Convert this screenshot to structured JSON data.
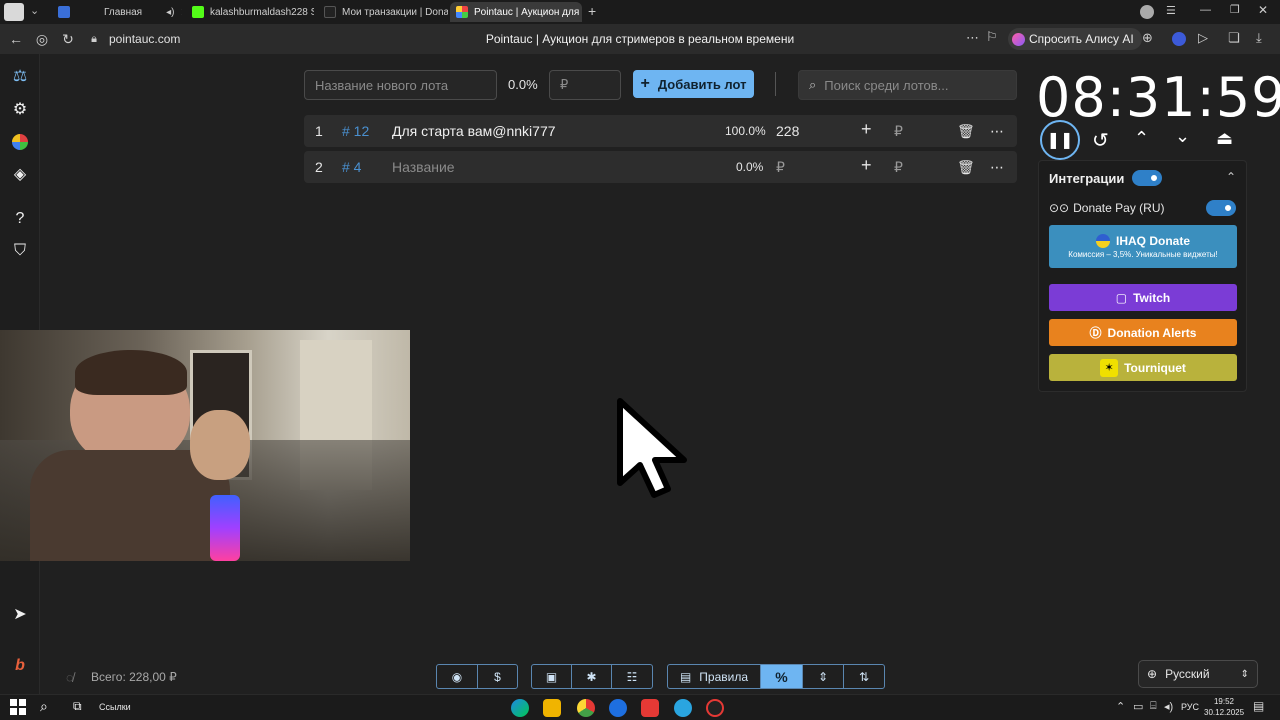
{
  "browser": {
    "tabs": [
      {
        "label": "Главная"
      },
      {
        "label": "kalashburmaldash228 Stre"
      },
      {
        "label": "Мои транзакции | Donate"
      },
      {
        "label": "Pointauc | Аукцион для ст"
      }
    ],
    "url": "pointauc.com",
    "page_title": "Pointauc | Аукцион для стримеров в реальном времени",
    "alice_label": "Спросить Алису AI"
  },
  "toolbar": {
    "lot_name_placeholder": "Название нового лота",
    "percent": "0.0%",
    "amount_placeholder": "₽",
    "add_lot_label": "Добавить лот",
    "search_placeholder": "Поиск среди лотов..."
  },
  "lots": [
    {
      "index": "1",
      "id": "# 12",
      "name": "Для старта вам@nnki777",
      "percent": "100.0%",
      "amount": "228",
      "currency": "₽"
    },
    {
      "index": "2",
      "id": "# 4",
      "name": "Название",
      "percent": "0.0%",
      "amount": "₽",
      "currency": "₽"
    }
  ],
  "timer": {
    "value": "08:31:59"
  },
  "integrations": {
    "title": "Интеграции",
    "donate_pay": "Donate Pay (RU)",
    "ihaq_title": "IHAQ Donate",
    "ihaq_subtitle": "Комиссия – 3,5%. Уникальные виджеты!",
    "twitch": "Twitch",
    "donation_alerts": "Donation Alerts",
    "tourniquet": "Tourniquet"
  },
  "footer": {
    "total_label": "Всего: 228,00 ₽",
    "rules_label": "Правила",
    "language": "Русский"
  },
  "taskbar": {
    "links_label": "Ссылки",
    "lang": "РУС",
    "time": "19:52",
    "date": "30.12.2025"
  },
  "colors": {
    "accent": "#6eb5f2",
    "twitch": "#7b3cd6",
    "donation_alerts": "#e8821e",
    "tourniquet": "#b9b23c",
    "ihaq": "#3b8fbe"
  }
}
